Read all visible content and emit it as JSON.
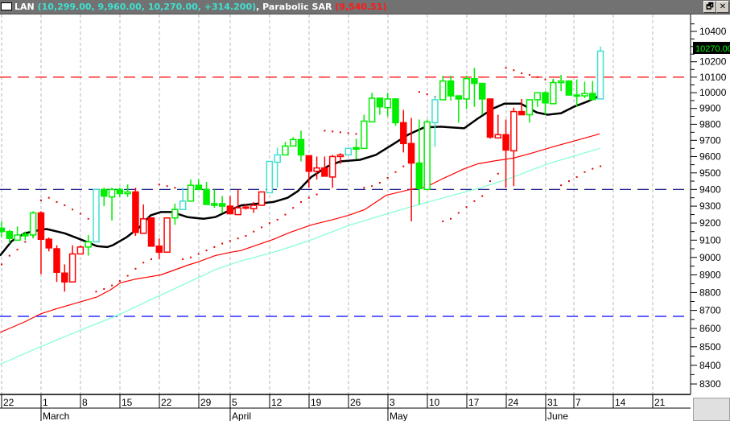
{
  "header": {
    "symbol": "LAN",
    "ohlc_text": "(10,299.00, 9,960.00, 10,270.00, +314.200)",
    "separator": ",",
    "indicator_name": "Parabolic SAR",
    "indicator_value": "(9,540.51)",
    "restore_icon": "restore-window-icon",
    "close_icon": "close-icon",
    "restore_label": "🗗",
    "close_label": "✕"
  },
  "colors": {
    "up_green": "#00ee00",
    "down_red": "#ff0000",
    "cyan": "#40e0d0",
    "ma_short": "#000000",
    "ma_mid": "#ff0000",
    "ma_long": "#7fffd4",
    "sar": "#e00000",
    "last_price_bg": "#000000",
    "last_price_fg": "#00ff00"
  },
  "chart_data": {
    "type": "candlestick",
    "symbol": "LAN",
    "y_scale": "log",
    "ylim": [
      8250,
      10480
    ],
    "y_ticks": [
      10400,
      10200,
      10100,
      10000,
      9900,
      9800,
      9700,
      9600,
      9500,
      9400,
      9300,
      9200,
      9100,
      9000,
      8900,
      8800,
      8700,
      8600,
      8500,
      8400,
      8300
    ],
    "y_tick_labels": [
      "10400",
      "10200",
      "10100",
      "10000",
      "9900",
      "9800",
      "9700",
      "9600",
      "9500",
      "9400",
      "9300",
      "9200",
      "9100",
      "9000",
      "8900",
      "8800",
      "8700",
      "8600",
      "8500",
      "8400",
      "8300"
    ],
    "last_price_label": "10270.00",
    "x_week_labels": [
      "22",
      "1",
      "8",
      "15",
      "22",
      "29",
      "5",
      "12",
      "19",
      "26",
      "3",
      "10",
      "17",
      "24",
      "31",
      "7",
      "14",
      "21"
    ],
    "x_month_labels": [
      "March",
      "April",
      "May",
      "June"
    ],
    "grid": "vertical dashed at weeks",
    "candle_fields": [
      "open",
      "high",
      "low",
      "close",
      "color"
    ],
    "candles": [
      [
        9170,
        9210,
        9115,
        9150,
        "green"
      ],
      [
        9150,
        9160,
        9080,
        9110,
        "green"
      ],
      [
        9100,
        9180,
        9100,
        9130,
        "green"
      ],
      [
        9135,
        9150,
        9100,
        9125,
        "green"
      ],
      [
        9130,
        9270,
        9110,
        9260,
        "green"
      ],
      [
        9260,
        9270,
        8905,
        9105,
        "red"
      ],
      [
        9105,
        9115,
        9035,
        9055,
        "red"
      ],
      [
        9050,
        9070,
        8860,
        8915,
        "red"
      ],
      [
        8910,
        8960,
        8805,
        8860,
        "red"
      ],
      [
        8860,
        9070,
        8860,
        9020,
        "red"
      ],
      [
        9020,
        9070,
        9020,
        9060,
        "red"
      ],
      [
        9060,
        9130,
        9010,
        9090,
        "green"
      ],
      [
        9090,
        9400,
        9090,
        9400,
        "cyan"
      ],
      [
        9400,
        9410,
        9300,
        9360,
        "green"
      ],
      [
        9355,
        9410,
        9215,
        9400,
        "green"
      ],
      [
        9400,
        9410,
        9355,
        9375,
        "green"
      ],
      [
        9375,
        9430,
        9355,
        9385,
        "green"
      ],
      [
        9385,
        9410,
        9125,
        9145,
        "red"
      ],
      [
        9140,
        9310,
        9140,
        9225,
        "red"
      ],
      [
        9230,
        9230,
        9065,
        9065,
        "red"
      ],
      [
        9065,
        9110,
        8990,
        9030,
        "red"
      ],
      [
        9030,
        9230,
        9030,
        9230,
        "red"
      ],
      [
        9230,
        9315,
        9190,
        9280,
        "green"
      ],
      [
        9280,
        9410,
        9280,
        9330,
        "cyan"
      ],
      [
        9330,
        9460,
        9330,
        9425,
        "green"
      ],
      [
        9425,
        9460,
        9400,
        9400,
        "green"
      ],
      [
        9400,
        9445,
        9310,
        9310,
        "green"
      ],
      [
        9315,
        9400,
        9290,
        9305,
        "green"
      ],
      [
        9315,
        9360,
        9260,
        9300,
        "green"
      ],
      [
        9300,
        9360,
        9255,
        9255,
        "red"
      ],
      [
        9250,
        9400,
        9250,
        9290,
        "red"
      ],
      [
        9290,
        9315,
        9280,
        9295,
        "red"
      ],
      [
        9285,
        9325,
        9260,
        9305,
        "red"
      ],
      [
        9305,
        9385,
        9305,
        9385,
        "red"
      ],
      [
        9380,
        9570,
        9380,
        9570,
        "cyan"
      ],
      [
        9565,
        9655,
        9410,
        9610,
        "cyan"
      ],
      [
        9610,
        9690,
        9610,
        9665,
        "green"
      ],
      [
        9665,
        9720,
        9665,
        9705,
        "green"
      ],
      [
        9705,
        9760,
        9570,
        9610,
        "green"
      ],
      [
        9605,
        9605,
        9410,
        9510,
        "red"
      ],
      [
        9510,
        9600,
        9460,
        9530,
        "red"
      ],
      [
        9530,
        9600,
        9480,
        9480,
        "red"
      ],
      [
        9475,
        9610,
        9410,
        9600,
        "red"
      ],
      [
        9600,
        9620,
        9555,
        9610,
        "red"
      ],
      [
        9610,
        9650,
        9610,
        9650,
        "cyan"
      ],
      [
        9655,
        9710,
        9585,
        9645,
        "green"
      ],
      [
        9650,
        9860,
        9650,
        9820,
        "green"
      ],
      [
        9815,
        10000,
        9815,
        9965,
        "green"
      ],
      [
        9965,
        9965,
        9860,
        9910,
        "green"
      ],
      [
        9905,
        10000,
        9850,
        9960,
        "green"
      ],
      [
        9960,
        9965,
        9790,
        9810,
        "green"
      ],
      [
        9810,
        9890,
        9625,
        9680,
        "red"
      ],
      [
        9680,
        9840,
        9210,
        9560,
        "red"
      ],
      [
        9560,
        9830,
        9310,
        9405,
        "green"
      ],
      [
        9400,
        9830,
        9400,
        9815,
        "green"
      ],
      [
        9810,
        9980,
        9660,
        9955,
        "cyan"
      ],
      [
        9955,
        10110,
        9955,
        10075,
        "green"
      ],
      [
        10075,
        10110,
        9950,
        9980,
        "green"
      ],
      [
        9980,
        9980,
        9810,
        9960,
        "green"
      ],
      [
        9960,
        10110,
        9895,
        10090,
        "green"
      ],
      [
        10090,
        10160,
        9910,
        10060,
        "green"
      ],
      [
        10060,
        10060,
        9860,
        9960,
        "green"
      ],
      [
        9960,
        9960,
        9710,
        9720,
        "red"
      ],
      [
        9715,
        9860,
        9715,
        9735,
        "red"
      ],
      [
        9735,
        9830,
        9410,
        9640,
        "red"
      ],
      [
        9635,
        9905,
        9420,
        9880,
        "red"
      ],
      [
        9880,
        9960,
        9860,
        9860,
        "red"
      ],
      [
        9860,
        9955,
        9810,
        9955,
        "green"
      ],
      [
        9955,
        10000,
        9910,
        10000,
        "green"
      ],
      [
        10000,
        10010,
        9860,
        9935,
        "green"
      ],
      [
        9930,
        10090,
        9930,
        10065,
        "green"
      ],
      [
        10065,
        10115,
        10010,
        10075,
        "green"
      ],
      [
        10075,
        10080,
        9985,
        9985,
        "green"
      ],
      [
        9985,
        10085,
        9910,
        9980,
        "green"
      ],
      [
        9980,
        10070,
        9965,
        9995,
        "green"
      ],
      [
        9995,
        10075,
        9956,
        9956,
        "green"
      ],
      [
        9960,
        10299,
        9960,
        10270,
        "cyan"
      ]
    ],
    "parabolic_sar": [
      8960,
      9010,
      9045,
      9090,
      9125,
      9335,
      9350,
      9325,
      9305,
      9280,
      9255,
      9225,
      8805,
      8820,
      8840,
      8865,
      8895,
      8935,
      8970,
      8990,
      9430,
      9420,
      9410,
      8990,
      9000,
      9020,
      9040,
      9060,
      9080,
      9095,
      9110,
      9125,
      9150,
      9175,
      9200,
      9220,
      9250,
      9290,
      9325,
      9350,
      9370,
      9760,
      9755,
      9750,
      9745,
      9740,
      9410,
      9420,
      9440,
      9470,
      9505,
      9540,
      9575,
      10005,
      9990,
      9975,
      9210,
      9225,
      9260,
      9295,
      9330,
      9360,
      9450,
      9495,
      10160,
      10145,
      10125,
      10115,
      10100,
      10085,
      10075,
      9425,
      9450,
      9475,
      9505,
      9525,
      9540.51
    ],
    "moving_averages": [
      {
        "color": "#000000",
        "points": [
          [
            -0.2,
            9010
          ],
          [
            1.3,
            9095
          ],
          [
            2.9,
            9140
          ],
          [
            4.9,
            9160
          ],
          [
            5.7,
            9165
          ],
          [
            8,
            9140
          ],
          [
            10,
            9105
          ],
          [
            12.1,
            9065
          ],
          [
            13.4,
            9060
          ],
          [
            14.1,
            9070
          ],
          [
            15.8,
            9115
          ],
          [
            17.5,
            9175
          ],
          [
            18.9,
            9245
          ],
          [
            20.2,
            9265
          ],
          [
            21.6,
            9265
          ],
          [
            23.6,
            9235
          ],
          [
            25.6,
            9225
          ],
          [
            27.1,
            9235
          ],
          [
            28.7,
            9270
          ],
          [
            30.4,
            9305
          ],
          [
            32.5,
            9315
          ],
          [
            34.5,
            9325
          ],
          [
            36.3,
            9350
          ],
          [
            37.6,
            9390
          ],
          [
            39.3,
            9475
          ],
          [
            41.4,
            9540
          ],
          [
            43,
            9570
          ],
          [
            45.5,
            9580
          ],
          [
            47.5,
            9610
          ],
          [
            49.5,
            9670
          ],
          [
            51.6,
            9735
          ],
          [
            53.6,
            9780
          ],
          [
            55.7,
            9785
          ],
          [
            58.7,
            9775
          ],
          [
            60.4,
            9835
          ],
          [
            62.4,
            9900
          ],
          [
            63.8,
            9930
          ],
          [
            65.9,
            9930
          ],
          [
            67.9,
            9875
          ],
          [
            69.3,
            9860
          ],
          [
            71,
            9870
          ],
          [
            72.6,
            9910
          ],
          [
            74.4,
            9945
          ],
          [
            75.9,
            9980
          ]
        ]
      },
      {
        "color": "#ff0000",
        "points": [
          [
            -0.2,
            8578
          ],
          [
            2.9,
            8636
          ],
          [
            4.9,
            8680
          ],
          [
            7,
            8710
          ],
          [
            9,
            8735
          ],
          [
            12.1,
            8775
          ],
          [
            13.8,
            8815
          ],
          [
            15.1,
            8855
          ],
          [
            16.9,
            8875
          ],
          [
            18.9,
            8890
          ],
          [
            20.2,
            8900
          ],
          [
            23.6,
            8955
          ],
          [
            25,
            8975
          ],
          [
            27.1,
            9010
          ],
          [
            29.1,
            9030
          ],
          [
            30.4,
            9040
          ],
          [
            34.5,
            9105
          ],
          [
            36.6,
            9145
          ],
          [
            39.4,
            9190
          ],
          [
            42,
            9220
          ],
          [
            44,
            9245
          ],
          [
            46.1,
            9280
          ],
          [
            48.8,
            9365
          ],
          [
            51.9,
            9400
          ],
          [
            53.9,
            9415
          ],
          [
            56,
            9465
          ],
          [
            58.7,
            9525
          ],
          [
            60.4,
            9555
          ],
          [
            62.8,
            9575
          ],
          [
            64.9,
            9590
          ],
          [
            67.2,
            9620
          ],
          [
            70,
            9660
          ],
          [
            72.6,
            9695
          ],
          [
            75.9,
            9740
          ]
        ]
      },
      {
        "color": "#7fffd4",
        "points": [
          [
            -0.2,
            8405
          ],
          [
            4.9,
            8500
          ],
          [
            10,
            8590
          ],
          [
            15.1,
            8680
          ],
          [
            19.4,
            8770
          ],
          [
            23.6,
            8855
          ],
          [
            27.1,
            8930
          ],
          [
            30.4,
            8980
          ],
          [
            34.5,
            9030
          ],
          [
            38.6,
            9090
          ],
          [
            44,
            9185
          ],
          [
            46.8,
            9225
          ],
          [
            51.9,
            9295
          ],
          [
            55.7,
            9345
          ],
          [
            60.8,
            9410
          ],
          [
            64.1,
            9460
          ],
          [
            69.3,
            9555
          ],
          [
            75.9,
            9650
          ]
        ]
      }
    ],
    "horizontal_lines": [
      {
        "price": 10100,
        "color": "#ff0000",
        "style": "dashed"
      },
      {
        "price": 9400,
        "color": "#000080",
        "style": "dashed"
      },
      {
        "price": 8667,
        "color": "#0000ff",
        "style": "dashed"
      }
    ]
  }
}
